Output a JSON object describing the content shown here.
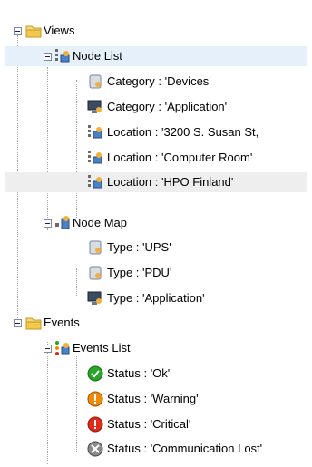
{
  "tree": {
    "views": {
      "label": "Views",
      "node_list": {
        "label": "Node List",
        "items": [
          {
            "label": "Category : 'Devices'"
          },
          {
            "label": "Category : 'Application'"
          },
          {
            "label": "Location : '3200 S. Susan St,"
          },
          {
            "label": "Location : 'Computer Room'"
          },
          {
            "label": "Location : 'HPO Finland'"
          }
        ]
      },
      "node_map": {
        "label": "Node Map",
        "items": [
          {
            "label": "Type : 'UPS'"
          },
          {
            "label": "Type : 'PDU'"
          },
          {
            "label": "Type : 'Application'"
          }
        ]
      }
    },
    "events": {
      "label": "Events",
      "events_list": {
        "label": "Events List",
        "items": [
          {
            "label": "Status : 'Ok'"
          },
          {
            "label": "Status : 'Warning'"
          },
          {
            "label": "Status : 'Critical'"
          },
          {
            "label": "Status : 'Communication Lost'"
          }
        ]
      }
    }
  },
  "colors": {
    "folder": "#f2c94c",
    "selected_row": "#e6f0fb",
    "hover_row": "#eeeeee",
    "status_ok": "#2aa52a",
    "status_warning": "#f08a00",
    "status_critical": "#e02a1a",
    "status_lost": "#8a8a8a"
  }
}
